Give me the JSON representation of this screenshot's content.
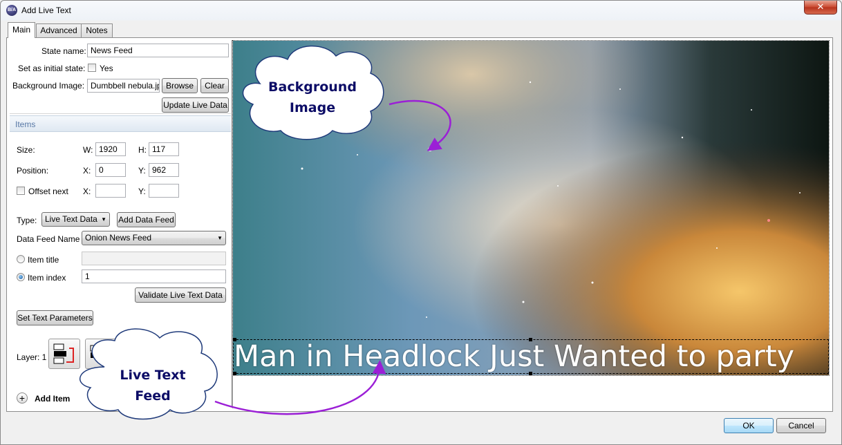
{
  "window": {
    "title": "Add Live Text",
    "app_icon_text": "B/A"
  },
  "tabs": [
    {
      "label": "Main"
    },
    {
      "label": "Advanced"
    },
    {
      "label": "Notes"
    }
  ],
  "state": {
    "name_label": "State name:",
    "name_value": "News Feed",
    "initial_label": "Set as initial state:",
    "initial_option": "Yes",
    "bg_label": "Background Image:",
    "bg_value": "Dumbbell nebula.jpg",
    "browse": "Browse",
    "clear": "Clear",
    "update": "Update Live Data"
  },
  "items": {
    "header": "Items",
    "size_label": "Size:",
    "w_label": "W:",
    "w_value": "1920",
    "h_label": "H:",
    "h_value": "117",
    "pos_label": "Position:",
    "x_label": "X:",
    "x_value": "0",
    "y_label": "Y:",
    "y_value": "962",
    "offset_label": "Offset next",
    "ox_label": "X:",
    "oy_label": "Y:",
    "type_label": "Type:",
    "type_value": "Live Text Data",
    "add_feed": "Add Data Feed",
    "feed_name_label": "Data Feed Name",
    "feed_name_value": "Onion News Feed",
    "item_title_label": "Item title",
    "item_index_label": "Item index",
    "item_index_value": "1",
    "validate": "Validate Live Text Data",
    "set_params": "Set Text Parameters",
    "layer_label": "Layer: 1",
    "add_item": "Add Item"
  },
  "preview": {
    "ticker_text": "Man in Headlock Just Wanted to party"
  },
  "callouts": {
    "background": "Background\nImage",
    "livetext": "Live Text\nFeed"
  },
  "footer": {
    "ok": "OK",
    "cancel": "Cancel"
  },
  "colors": {
    "callout_text": "#0c0c66",
    "arrow": "#9b1fd6",
    "section_header": "#5878a6"
  }
}
